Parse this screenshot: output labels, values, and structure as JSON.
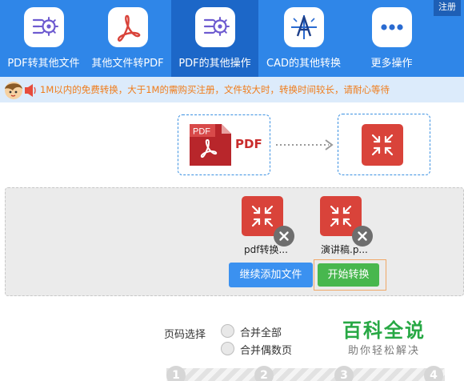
{
  "nav": {
    "items": [
      {
        "label": "PDF转其他文件",
        "icon": "pdf-settings-icon",
        "active": false
      },
      {
        "label": "其他文件转PDF",
        "icon": "acrobat-icon",
        "active": false
      },
      {
        "label": "PDF的其他操作",
        "icon": "pdf-settings-icon",
        "active": true
      },
      {
        "label": "CAD的其他转换",
        "icon": "cad-drawing-icon",
        "active": false
      },
      {
        "label": "更多操作",
        "icon": "more-dots-icon",
        "active": false
      }
    ],
    "register_label": "注册"
  },
  "notice": {
    "text": "1M以内的免费转换，大于1M的需购买注册，文件较大时，转换时间较长，请耐心等待",
    "icon": "mascot-speaker-icon"
  },
  "converter": {
    "source_doc_label": "PDF",
    "source_word": "PDF",
    "target_icon": "compress-icon"
  },
  "files": [
    {
      "name": "pdf转换..."
    },
    {
      "name": "演讲稿.p..."
    }
  ],
  "buttons": {
    "add_label": "继续添加文件",
    "start_label": "开始转换"
  },
  "options": {
    "label": "页码选择",
    "choices": [
      "合并全部",
      "合并偶数页"
    ]
  },
  "watermark": {
    "title": "百科全说",
    "subtitle": "助你轻松解决"
  },
  "steps": [
    "1",
    "2",
    "3",
    "4"
  ],
  "colors": {
    "nav_bg": "#2f86e8",
    "nav_active": "#1c67c8",
    "notice_bg": "#dcebfb",
    "notice_text": "#f07c1a",
    "red_tile": "#d9433a",
    "add_button": "#3b91f0",
    "start_button": "#48b74e",
    "watermark": "#27a844"
  }
}
